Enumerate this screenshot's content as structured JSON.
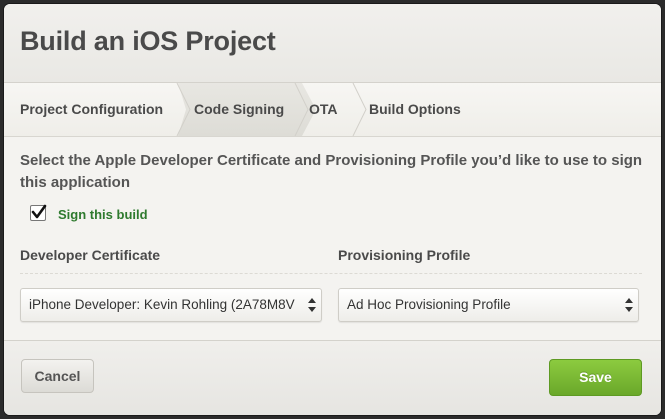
{
  "dialog": {
    "title": "Build an iOS Project"
  },
  "tabs": [
    {
      "label": "Project Configuration",
      "active": false
    },
    {
      "label": "Code Signing",
      "active": true
    },
    {
      "label": "OTA",
      "active": false
    },
    {
      "label": "Build Options",
      "active": false
    }
  ],
  "signing": {
    "intro": "Select the Apple Developer Certificate and Provisioning Profile you’d like to use to sign this application",
    "sign_checkbox_label": "Sign this build",
    "sign_checked": true,
    "certificate_label": "Developer Certificate",
    "certificate_value": "iPhone Developer: Kevin Rohling (2A78M8V",
    "profile_label": "Provisioning Profile",
    "profile_value": "Ad Hoc Provisioning Profile"
  },
  "footer": {
    "cancel_label": "Cancel",
    "save_label": "Save"
  },
  "colors": {
    "accent_green": "#7aba35",
    "check_label_green": "#2e7a2e"
  }
}
